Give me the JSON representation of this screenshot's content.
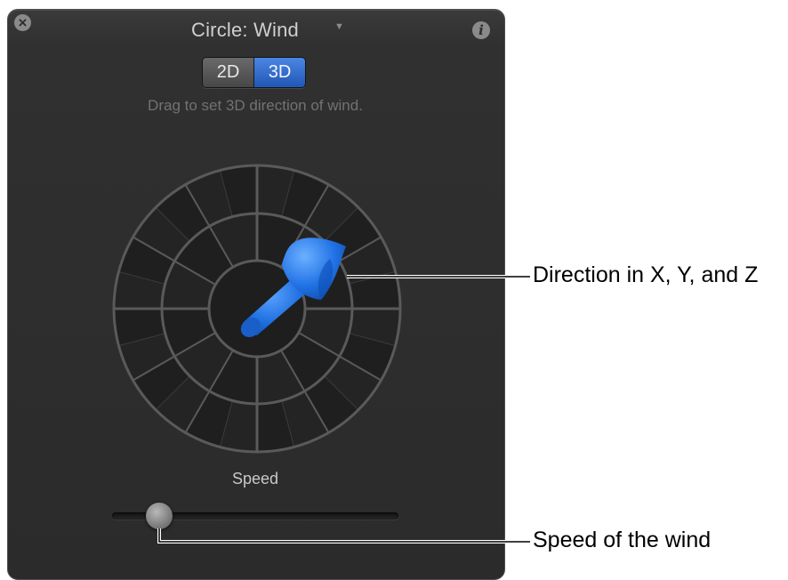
{
  "hud": {
    "title": "Circle: Wind",
    "close_icon": "close-icon",
    "info_icon": "info-icon",
    "dropdown_icon": "triangle-down-icon",
    "mode_toggle": {
      "options": [
        "2D",
        "3D"
      ],
      "selected": "3D"
    },
    "hint": "Drag to set 3D direction of wind.",
    "speed": {
      "label": "Speed",
      "value_fraction": 0.14
    }
  },
  "callouts": {
    "direction": "Direction in X, Y, and Z",
    "speed": "Speed of the wind"
  },
  "colors": {
    "hud_background": "#2b2b2b",
    "accent_blue": "#2a6ed6",
    "arrow_blue": "#1f6fe0"
  }
}
